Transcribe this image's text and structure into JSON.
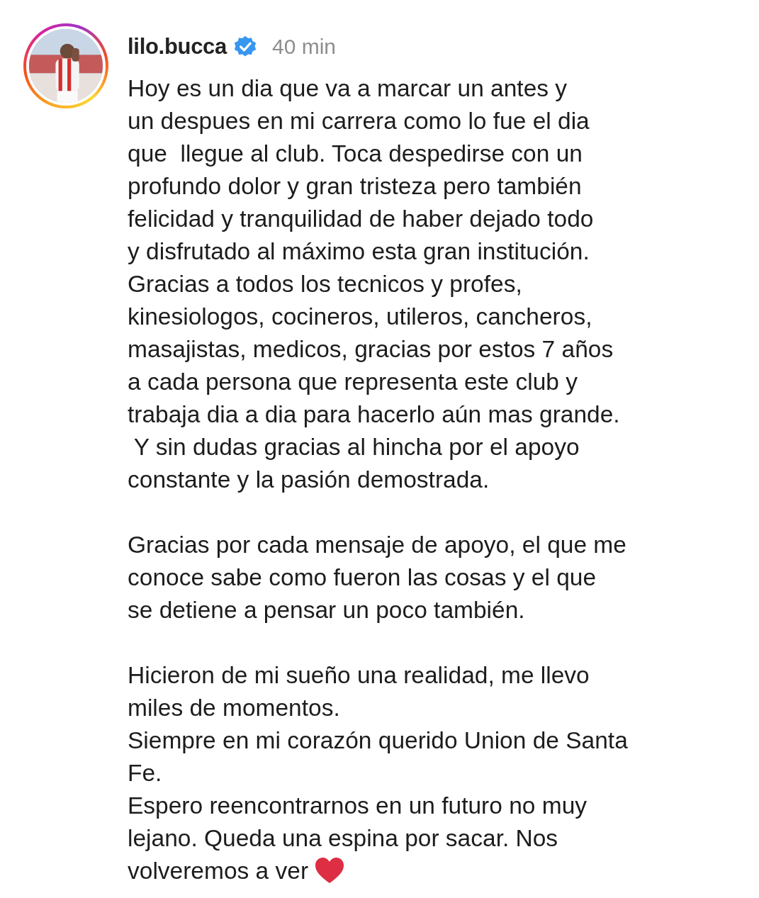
{
  "post": {
    "avatar": {
      "kind": "picture",
      "story_ring": true
    },
    "username": "lilo.bucca",
    "verified": true,
    "time": "40 min",
    "caption": [
      {
        "lines": [
          "Hoy es un dia que va a marcar un antes y",
          "un despues en mi carrera como lo fue el dia",
          "que  llegue al club. Toca despedirse con un",
          "profundo dolor y gran tristeza pero también",
          "felicidad y tranquilidad de haber dejado todo",
          "y disfrutado al máximo esta gran institución.",
          "Gracias a todos los tecnicos y profes,",
          "kinesiologos, cocineros, utileros, cancheros,",
          "masajistas, medicos, gracias por estos 7 años",
          "a cada persona que representa este club y",
          "trabaja dia a dia para hacerlo aún mas grande.",
          " Y sin dudas gracias al hincha por el apoyo",
          "constante y la pasión demostrada."
        ]
      },
      {
        "lines": [
          "Gracias por cada mensaje de apoyo, el que me",
          "conoce sabe como fueron las cosas y el que",
          "se detiene a pensar un poco también."
        ]
      },
      {
        "lines": [
          "Hicieron de mi sueño una realidad, me llevo",
          "miles de momentos.",
          "Siempre en mi corazón querido Union de Santa",
          "Fe.",
          "Espero reencontrarnos en un futuro no muy",
          "lejano. Queda una espina por sacar. Nos",
          "volveremos a ver"
        ],
        "heart_at_end": true
      }
    ]
  }
}
